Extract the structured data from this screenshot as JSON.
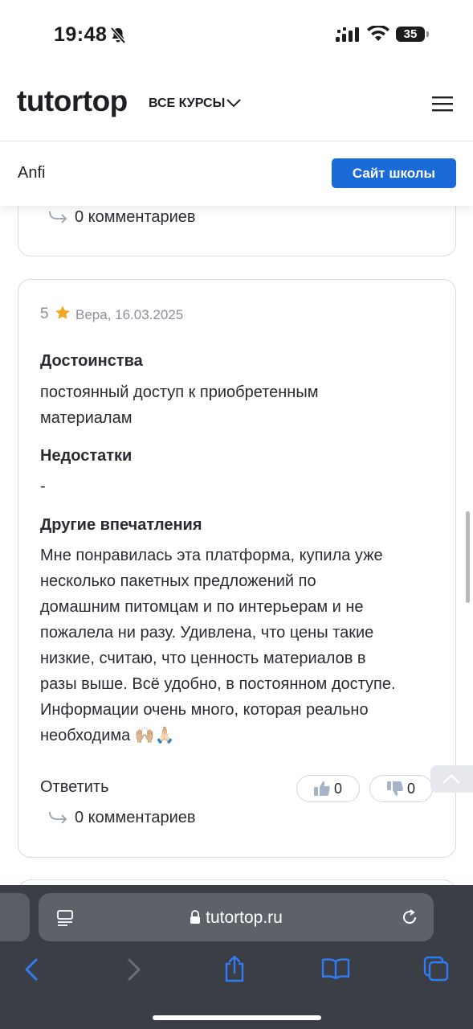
{
  "status_bar": {
    "time": "19:48",
    "battery": "35"
  },
  "header": {
    "logo": "tutortop",
    "courses_label": "ВСЕ КУРСЫ"
  },
  "school": {
    "name": "Anfi",
    "site_button": "Сайт школы"
  },
  "prev_review": {
    "comments": "0 комментариев"
  },
  "review": {
    "rating": "5",
    "author_date": "Вера, 16.03.2025",
    "pros_title": "Достоинства",
    "pros_lines": [
      "постоянный доступ к приобретенным",
      "материалам"
    ],
    "cons_title": "Недостатки",
    "cons_text": "-",
    "other_title": "Другие впечатления",
    "other_lines": [
      "Мне понравилась эта платформа, купила уже",
      "несколько пакетных предложений по",
      "домашним питомцам и по интерьерам и не",
      "пожалела ни разу. Удивлена, что цены такие",
      "низкие, считаю, что ценность материалов в",
      "разы выше. Всё удобно, в постоянном доступе.",
      "Информации очень много, которая реально",
      "необходима 🙌🏼🙏🏻"
    ],
    "reply_label": "Ответить",
    "likes": "0",
    "dislikes": "0",
    "comments": "0 комментариев"
  },
  "browser": {
    "url": "tutortop.ru"
  },
  "colors": {
    "accent": "#1a6ad8",
    "star": "#f5a524",
    "toolbar": "#3b3e44",
    "toolbar_icon": "#2f7df6"
  }
}
